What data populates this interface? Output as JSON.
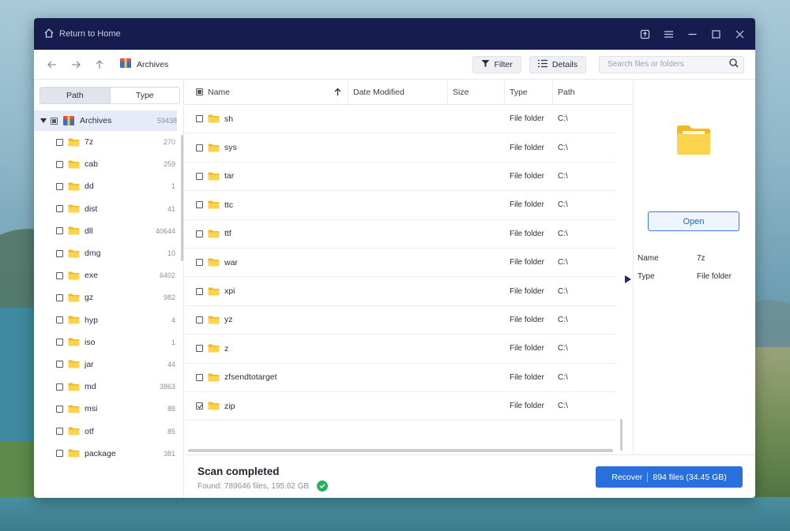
{
  "titlebar": {
    "home_label": "Return to Home"
  },
  "toolbar": {
    "breadcrumb": "Archives",
    "filter_label": "Filter",
    "details_label": "Details",
    "search_placeholder": "Search files or folders"
  },
  "sidebar": {
    "tabs": {
      "path": "Path",
      "type": "Type"
    },
    "root": {
      "label": "Archives",
      "count": "59438"
    },
    "items": [
      {
        "label": "7z",
        "count": "270"
      },
      {
        "label": "cab",
        "count": "259"
      },
      {
        "label": "dd",
        "count": "1"
      },
      {
        "label": "dist",
        "count": "41"
      },
      {
        "label": "dll",
        "count": "40644"
      },
      {
        "label": "dmg",
        "count": "10"
      },
      {
        "label": "exe",
        "count": "6402"
      },
      {
        "label": "gz",
        "count": "982"
      },
      {
        "label": "hyp",
        "count": "4"
      },
      {
        "label": "iso",
        "count": "1"
      },
      {
        "label": "jar",
        "count": "44"
      },
      {
        "label": "md",
        "count": "3863"
      },
      {
        "label": "msi",
        "count": "88"
      },
      {
        "label": "otf",
        "count": "85"
      },
      {
        "label": "package",
        "count": "381"
      }
    ]
  },
  "table": {
    "headers": {
      "name": "Name",
      "date": "Date Modified",
      "size": "Size",
      "type": "Type",
      "path": "Path"
    },
    "rows": [
      {
        "name": "sh",
        "type": "File folder",
        "path": "C:\\",
        "checked": false
      },
      {
        "name": "sys",
        "type": "File folder",
        "path": "C:\\",
        "checked": false
      },
      {
        "name": "tar",
        "type": "File folder",
        "path": "C:\\",
        "checked": false
      },
      {
        "name": "ttc",
        "type": "File folder",
        "path": "C:\\",
        "checked": false
      },
      {
        "name": "ttf",
        "type": "File folder",
        "path": "C:\\",
        "checked": false
      },
      {
        "name": "war",
        "type": "File folder",
        "path": "C:\\",
        "checked": false
      },
      {
        "name": "xpi",
        "type": "File folder",
        "path": "C:\\",
        "checked": false
      },
      {
        "name": "yz",
        "type": "File folder",
        "path": "C:\\",
        "checked": false
      },
      {
        "name": "z",
        "type": "File folder",
        "path": "C:\\",
        "checked": false
      },
      {
        "name": "zfsendtotarget",
        "type": "File folder",
        "path": "C:\\",
        "checked": false
      },
      {
        "name": "zip",
        "type": "File folder",
        "path": "C:\\",
        "checked": true
      }
    ]
  },
  "details": {
    "open_label": "Open",
    "props": [
      {
        "key": "Name",
        "value": "7z"
      },
      {
        "key": "Type",
        "value": "File folder"
      }
    ]
  },
  "footer": {
    "scan_title": "Scan completed",
    "scan_found": "Found: 789646 files, 195.62 GB",
    "recover_label": "Recover",
    "recover_summary": "894 files (34.45 GB)"
  },
  "colors": {
    "titlebar": "#161d4e",
    "accent": "#2a6fde",
    "folder": "#f7c531",
    "success": "#27b25f"
  }
}
